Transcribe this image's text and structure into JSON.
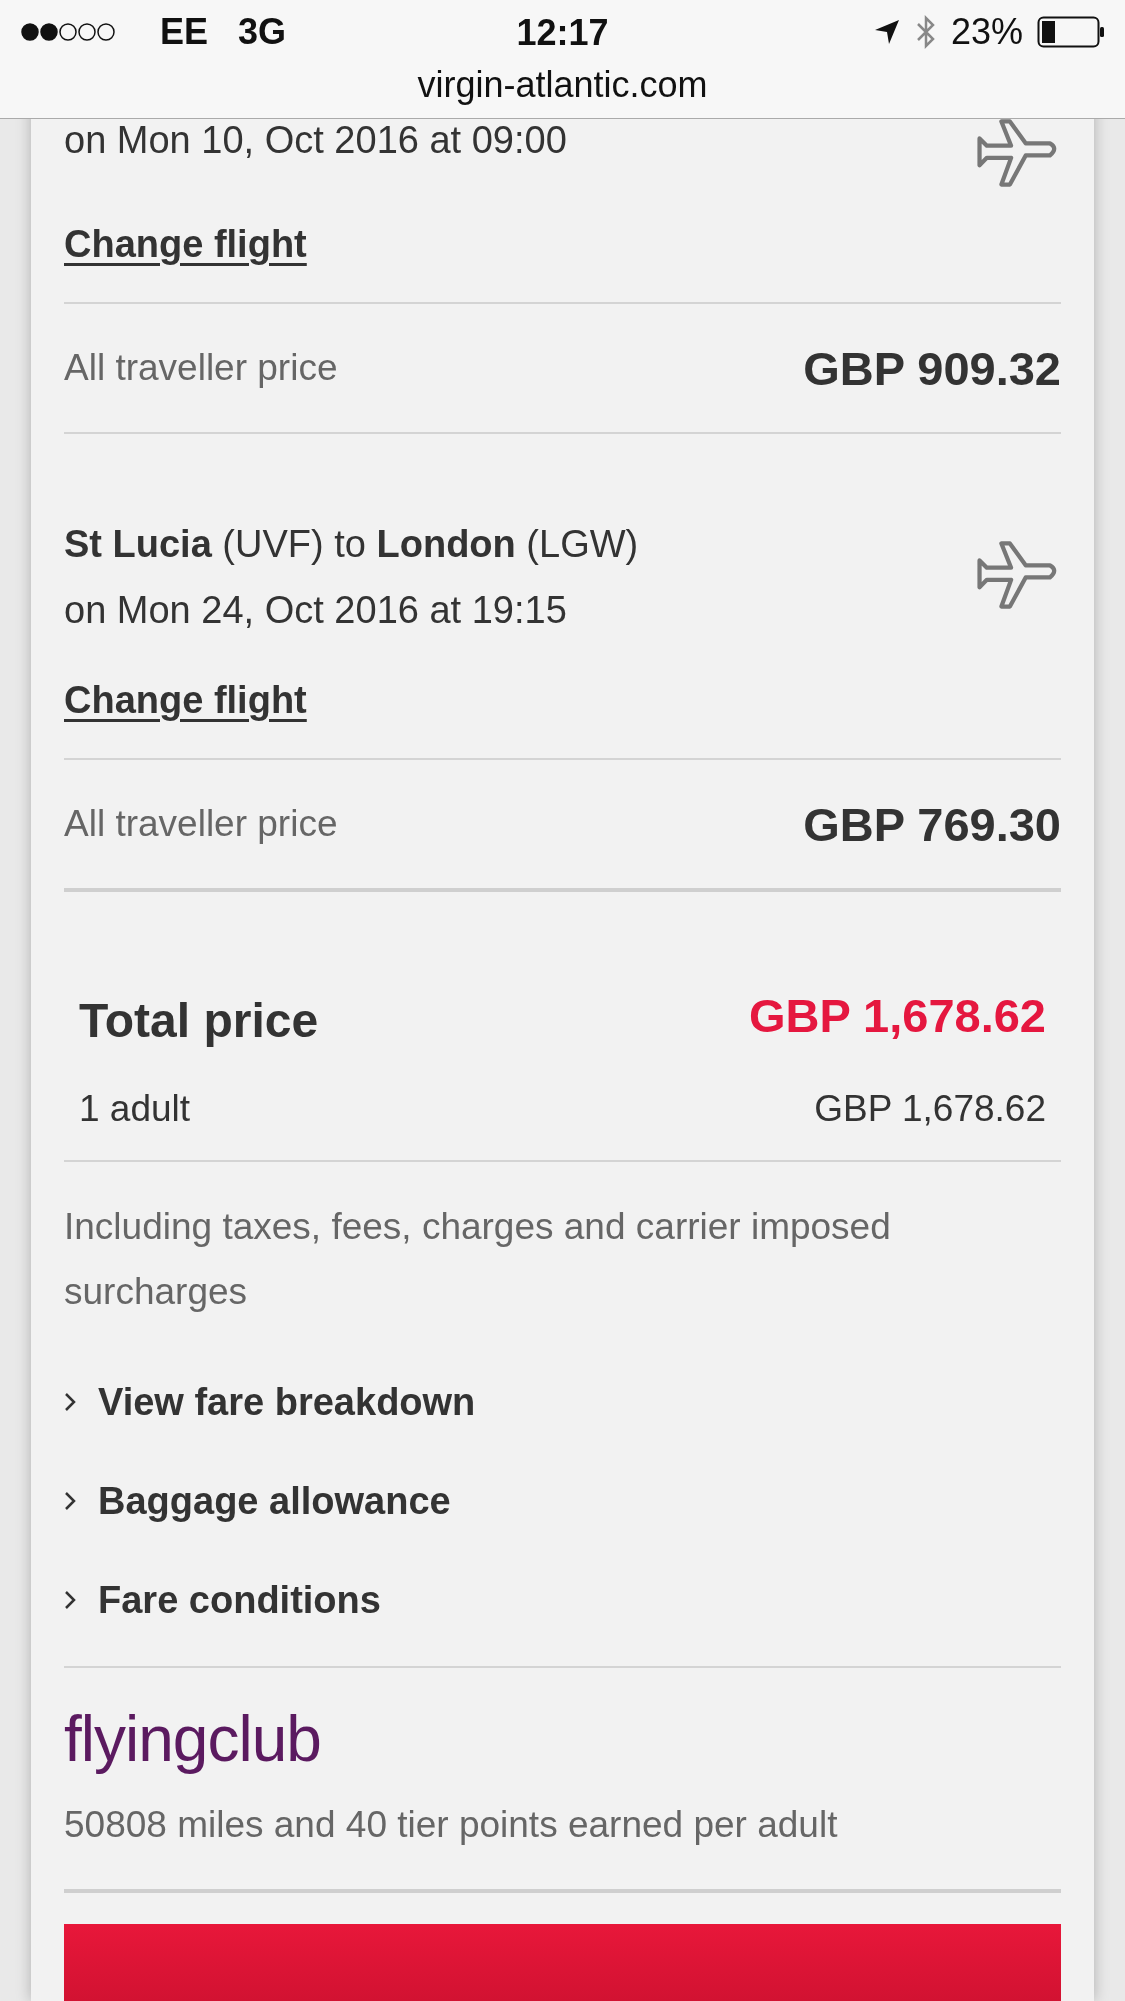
{
  "status_bar": {
    "carrier": "EE",
    "network": "3G",
    "time": "12:17",
    "battery": "23%"
  },
  "address_bar": {
    "url": "virgin-atlantic.com"
  },
  "flights": [
    {
      "date": "on Mon 10, Oct 2016 at 09:00",
      "change_link": "Change flight",
      "price_label": "All traveller price",
      "price": "GBP 909.32"
    },
    {
      "route": "**St Lucia** (UVF) to **London** (LGW)",
      "date": "on Mon 24, Oct 2016 at 19:15",
      "change_link": "Change flight",
      "price_label": "All traveller price",
      "price": "GBP 769.30"
    }
  ],
  "total": {
    "label": "Total price",
    "amount": "GBP 1,678.62",
    "rows": [
      {
        "label": "1 adult",
        "amount": "GBP 1,678.62"
      }
    ],
    "note": "Including taxes, fees, charges and carrier imposed surcharges"
  },
  "expanders": [
    {
      "label": "View fare breakdown",
      "expanded": false
    },
    {
      "label": "Baggage allowance",
      "expanded": false
    },
    {
      "label": "Fare conditions",
      "expanded": false
    }
  ],
  "loyalty": {
    "brand": "flyingclub",
    "text": "50808 miles and 40 tier points earned per adult"
  }
}
